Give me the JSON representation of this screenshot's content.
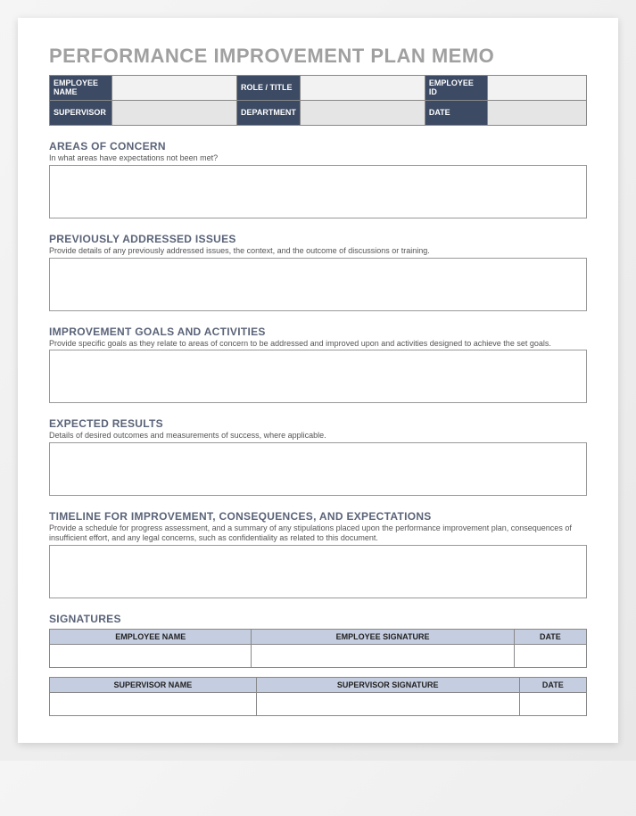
{
  "title": "PERFORMANCE IMPROVEMENT PLAN MEMO",
  "header": {
    "employee_name_label": "EMPLOYEE NAME",
    "role_label": "ROLE / TITLE",
    "employee_id_label": "EMPLOYEE ID",
    "supervisor_label": "SUPERVISOR",
    "department_label": "DEPARTMENT",
    "date_label": "DATE",
    "employee_name": "",
    "role": "",
    "employee_id": "",
    "supervisor": "",
    "department": "",
    "date": ""
  },
  "sections": {
    "concern": {
      "heading": "AREAS OF CONCERN",
      "sub": "In what areas have expectations not been met?"
    },
    "previous": {
      "heading": "PREVIOUSLY ADDRESSED ISSUES",
      "sub": "Provide details of any previously addressed issues, the context, and the outcome of discussions or training."
    },
    "goals": {
      "heading": "IMPROVEMENT GOALS AND ACTIVITIES",
      "sub": "Provide specific goals as they relate to areas of concern to be addressed and improved upon and activities designed to achieve the set goals."
    },
    "results": {
      "heading": "EXPECTED RESULTS",
      "sub": "Details of desired outcomes and measurements of success, where applicable."
    },
    "timeline": {
      "heading": "TIMELINE FOR IMPROVEMENT, CONSEQUENCES, AND EXPECTATIONS",
      "sub": "Provide a schedule for progress assessment, and a summary of any stipulations placed upon the performance improvement plan, consequences of insufficient effort, and any legal concerns, such as confidentiality as related to this document."
    },
    "signatures": {
      "heading": "SIGNATURES",
      "emp_name": "EMPLOYEE NAME",
      "emp_sig": "EMPLOYEE SIGNATURE",
      "date": "DATE",
      "sup_name": "SUPERVISOR NAME",
      "sup_sig": "SUPERVISOR SIGNATURE"
    }
  }
}
